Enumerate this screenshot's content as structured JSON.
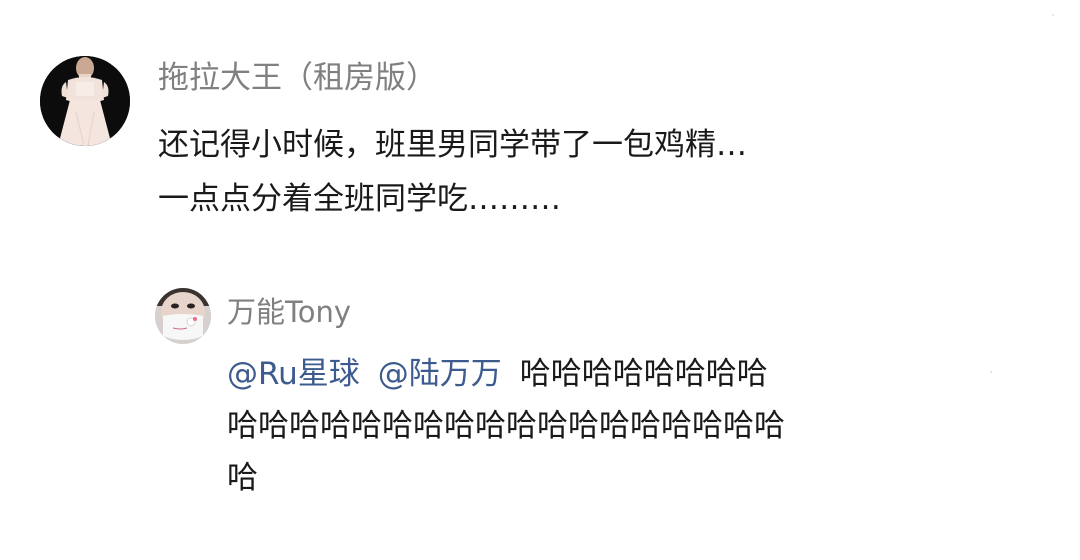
{
  "top_comment": {
    "username": "拖拉大王（租房版）",
    "text_lines": [
      "还记得小时候，班里男同学带了一包鸡精…",
      "一点点分着全班同学吃………"
    ],
    "avatar": "dress-girl-avatar"
  },
  "reply": {
    "username": "万能Tony",
    "mention_1": "@Ru星球",
    "mention_2": "@陆万万",
    "text_parts": [
      "哈哈哈哈哈哈哈哈",
      "哈哈哈哈哈哈哈哈哈哈哈哈哈哈哈哈哈哈",
      "哈"
    ],
    "avatar": "hello-kitty-mask-avatar"
  },
  "colors": {
    "mention": "#3d5b8f",
    "username": "#808080",
    "text": "#1a1a1a"
  }
}
